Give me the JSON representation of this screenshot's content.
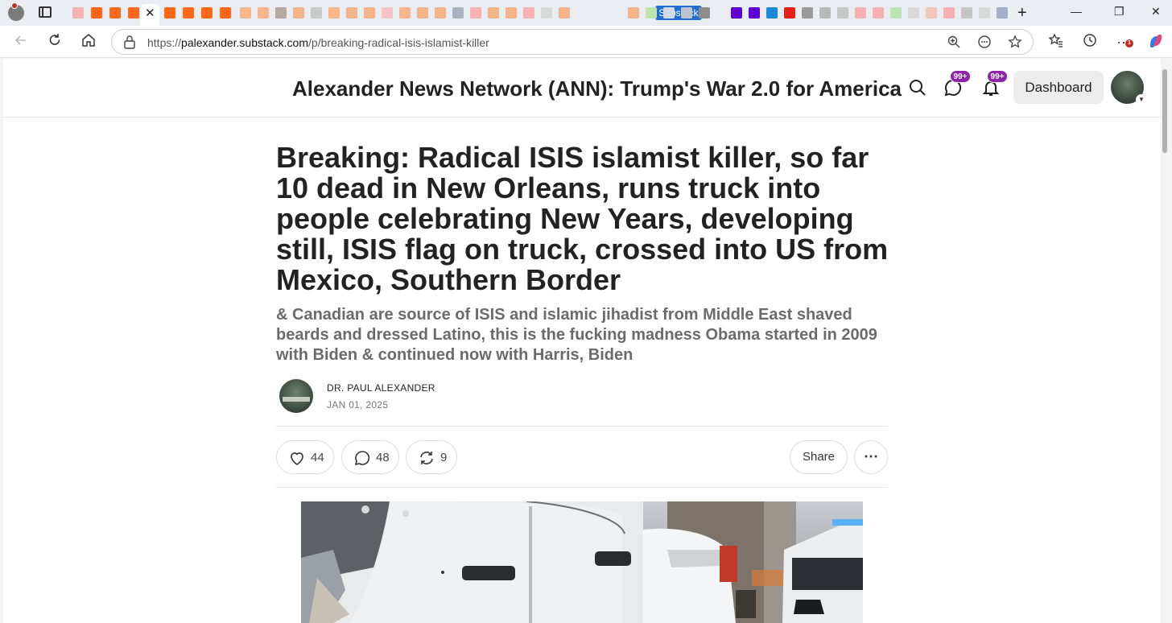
{
  "browser": {
    "active_tab_close": "✕",
    "substack_tab_label": "Substack",
    "new_tab": "+",
    "minimize": "—",
    "restore": "❐",
    "close": "✕",
    "url_domain": "palexander.substack.com",
    "url_path": "/p/breaking-radical-isis-islamist-killer",
    "url_prefix": "https://",
    "extensions_badge": "1"
  },
  "header": {
    "publication_title": "Alexander News Network (ANN): Trump's War 2.0 for America",
    "chat_badge": "99+",
    "notifications_badge": "99+",
    "dashboard_label": "Dashboard"
  },
  "post": {
    "title": "Breaking: Radical ISIS islamist killer, so far 10 dead in New Orleans, runs truck into people celebrating New Years, developing still, ISIS flag on truck, crossed into US from Mexico, Southern Border",
    "subtitle": "& Canadian are source of ISIS and islamic jihadist from Middle East shaved beards and dressed Latino, this is the fucking madness Obama started in 2009 with Biden & continued now with Harris, Biden",
    "author": "DR. PAUL ALEXANDER",
    "date": "JAN 01, 2025",
    "likes": "44",
    "comments": "48",
    "restacks": "9",
    "share_label": "Share",
    "more_label": "⋯"
  },
  "colors": {
    "badge_purple": "#8e24aa",
    "substack_blue": "#1f6fd1",
    "title_text": "#222222",
    "subtitle_text": "#6b6b6b"
  },
  "icons": {
    "toolbar": [
      "back-icon",
      "refresh-icon",
      "home-icon",
      "lock-icon",
      "zoom-icon",
      "reading-mode-icon",
      "star-icon",
      "favorites-icon",
      "history-icon",
      "more-icon",
      "copilot-icon"
    ],
    "header": [
      "search-icon",
      "chat-icon",
      "bell-icon"
    ],
    "post": [
      "heart-icon",
      "comment-icon",
      "restack-icon"
    ]
  }
}
